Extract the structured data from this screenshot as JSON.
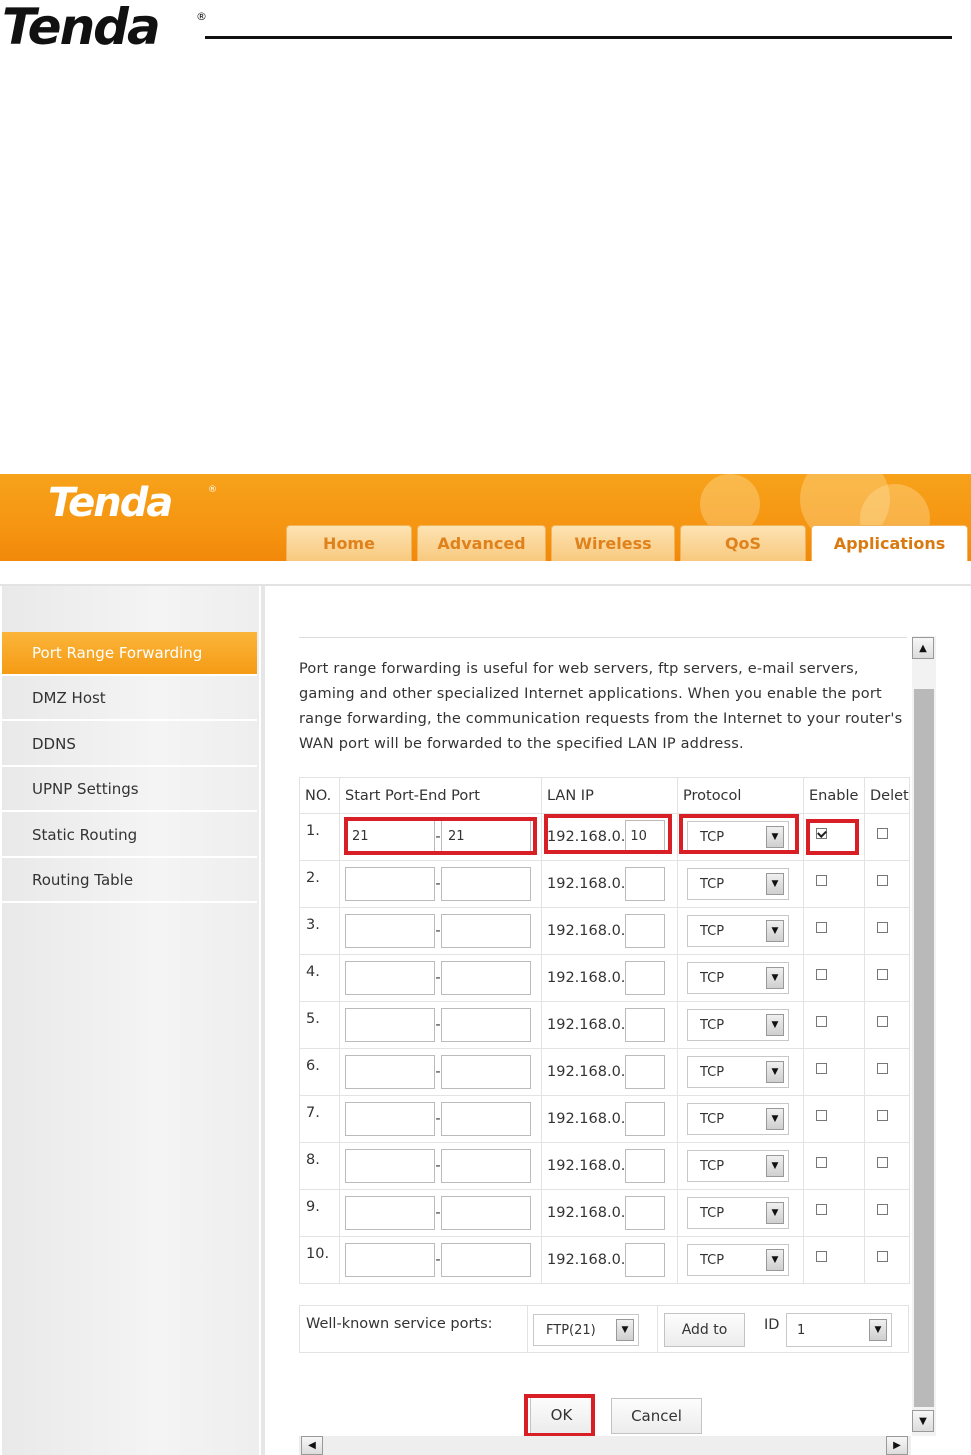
{
  "document": {
    "logo_text": "Tenda"
  },
  "router_ui": {
    "brand": "Tenda",
    "tabs": [
      {
        "label": "Home"
      },
      {
        "label": "Advanced"
      },
      {
        "label": "Wireless"
      },
      {
        "label": "QoS"
      },
      {
        "label": "Applications"
      }
    ],
    "active_tab": "Applications",
    "sidebar": {
      "items": [
        {
          "label": "Port Range Forwarding"
        },
        {
          "label": "DMZ Host"
        },
        {
          "label": "DDNS"
        },
        {
          "label": "UPNP Settings"
        },
        {
          "label": "Static Routing"
        },
        {
          "label": "Routing Table"
        }
      ],
      "active_item": "Port Range Forwarding"
    },
    "description": "Port range forwarding is useful for web servers, ftp servers, e-mail servers, gaming and other specialized Internet applications. When you enable the port range forwarding, the communication requests from the Internet to your router's WAN port will be forwarded to the specified LAN IP address.",
    "table": {
      "headers": {
        "no": "NO.",
        "ports": "Start Port-End Port",
        "lan_ip": "LAN IP",
        "protocol": "Protocol",
        "enable": "Enable",
        "delete": "Delet"
      },
      "dash": "-",
      "rows": [
        {
          "no": "1.",
          "start": "21",
          "end": "21",
          "ip_prefix": "192.168.0.",
          "ip_last": "10",
          "protocol": "TCP",
          "enabled": true,
          "delete": false
        },
        {
          "no": "2.",
          "start": "",
          "end": "",
          "ip_prefix": "192.168.0.",
          "ip_last": "",
          "protocol": "TCP",
          "enabled": false,
          "delete": false
        },
        {
          "no": "3.",
          "start": "",
          "end": "",
          "ip_prefix": "192.168.0.",
          "ip_last": "",
          "protocol": "TCP",
          "enabled": false,
          "delete": false
        },
        {
          "no": "4.",
          "start": "",
          "end": "",
          "ip_prefix": "192.168.0.",
          "ip_last": "",
          "protocol": "TCP",
          "enabled": false,
          "delete": false
        },
        {
          "no": "5.",
          "start": "",
          "end": "",
          "ip_prefix": "192.168.0.",
          "ip_last": "",
          "protocol": "TCP",
          "enabled": false,
          "delete": false
        },
        {
          "no": "6.",
          "start": "",
          "end": "",
          "ip_prefix": "192.168.0.",
          "ip_last": "",
          "protocol": "TCP",
          "enabled": false,
          "delete": false
        },
        {
          "no": "7.",
          "start": "",
          "end": "",
          "ip_prefix": "192.168.0.",
          "ip_last": "",
          "protocol": "TCP",
          "enabled": false,
          "delete": false
        },
        {
          "no": "8.",
          "start": "",
          "end": "",
          "ip_prefix": "192.168.0.",
          "ip_last": "",
          "protocol": "TCP",
          "enabled": false,
          "delete": false
        },
        {
          "no": "9.",
          "start": "",
          "end": "",
          "ip_prefix": "192.168.0.",
          "ip_last": "",
          "protocol": "TCP",
          "enabled": false,
          "delete": false
        },
        {
          "no": "10.",
          "start": "",
          "end": "",
          "ip_prefix": "192.168.0.",
          "ip_last": "",
          "protocol": "TCP",
          "enabled": false,
          "delete": false
        }
      ]
    },
    "well_known": {
      "label": "Well-known service ports:",
      "service": "FTP(21)",
      "add_button": "Add to",
      "id_label": "ID",
      "id_value": "1"
    },
    "buttons": {
      "ok": "OK",
      "cancel": "Cancel"
    },
    "colors": {
      "accent_orange": "#f59310",
      "highlight_red": "#d91f26"
    }
  }
}
